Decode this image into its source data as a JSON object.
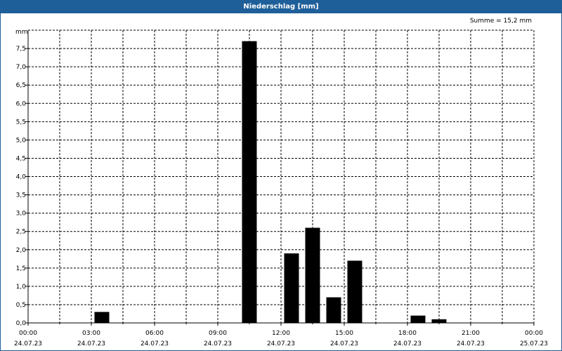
{
  "window": {
    "title": "Niederschlag [mm]"
  },
  "summary": {
    "text": "Summe = 15,2 mm"
  },
  "colors": {
    "titlebar": "#1f5f99",
    "bar": "#000000",
    "grid": "#000000"
  },
  "chart_data": {
    "type": "bar",
    "title": "Niederschlag [mm]",
    "ylabel": "mm",
    "ylim": [
      0,
      8
    ],
    "yticks": [
      "0,0",
      "0,5",
      "1,0",
      "1,5",
      "2,0",
      "2,5",
      "3,0",
      "3,5",
      "4,0",
      "4,5",
      "5,0",
      "5,5",
      "6,0",
      "6,5",
      "7,0",
      "7,5"
    ],
    "xlim_hours": [
      0,
      24
    ],
    "xticks": [
      {
        "time": "00:00",
        "date": "24.07.23"
      },
      {
        "time": "03:00",
        "date": "24.07.23"
      },
      {
        "time": "06:00",
        "date": "24.07.23"
      },
      {
        "time": "09:00",
        "date": "24.07.23"
      },
      {
        "time": "12:00",
        "date": "24.07.23"
      },
      {
        "time": "15:00",
        "date": "24.07.23"
      },
      {
        "time": "18:00",
        "date": "24.07.23"
      },
      {
        "time": "21:00",
        "date": "24.07.23"
      },
      {
        "time": "00:00",
        "date": "25.07.23"
      }
    ],
    "grid": true,
    "bars": [
      {
        "hour": 3,
        "value": 0.3
      },
      {
        "hour": 10,
        "value": 7.7
      },
      {
        "hour": 12,
        "value": 1.9
      },
      {
        "hour": 13,
        "value": 2.6
      },
      {
        "hour": 14,
        "value": 0.7
      },
      {
        "hour": 15,
        "value": 1.7
      },
      {
        "hour": 18,
        "value": 0.2
      },
      {
        "hour": 19,
        "value": 0.1
      }
    ]
  }
}
